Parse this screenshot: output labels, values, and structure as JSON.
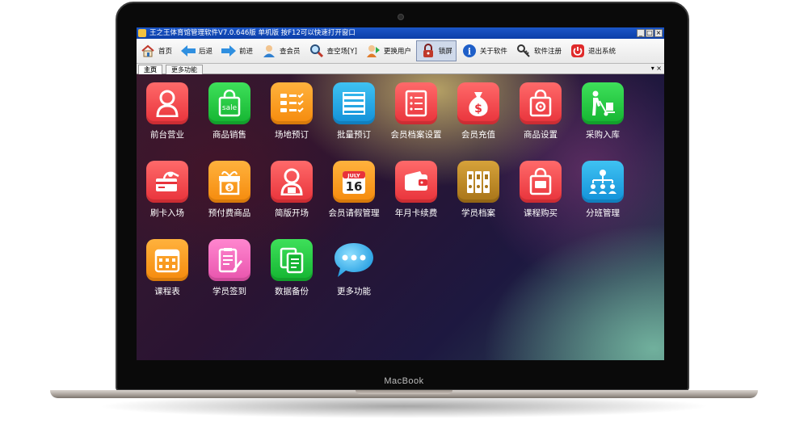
{
  "device": {
    "brand": "MacBook"
  },
  "window": {
    "title": "王之王体育馆管理软件V7.0.646版 单机版 按F12可以快速打开窗口",
    "controls": [
      "_",
      "□",
      "×"
    ]
  },
  "toolbar": {
    "items": [
      {
        "label": "首页",
        "icon": "home-icon"
      },
      {
        "label": "后退",
        "icon": "arrow-left-icon"
      },
      {
        "label": "前进",
        "icon": "arrow-right-icon"
      },
      {
        "label": "查会员",
        "icon": "member-search-icon"
      },
      {
        "label": "查空场[Y]",
        "icon": "magnifier-icon"
      },
      {
        "label": "更换用户",
        "icon": "switch-user-icon"
      },
      {
        "label": "锁屏",
        "icon": "lock-icon",
        "active": true
      },
      {
        "label": "关于软件",
        "icon": "info-icon"
      },
      {
        "label": "软件注册",
        "icon": "key-icon"
      },
      {
        "label": "退出系统",
        "icon": "power-icon"
      }
    ]
  },
  "tabs": {
    "items": [
      "主页",
      "更多功能"
    ],
    "selected": 0,
    "controls": "▾ ×"
  },
  "apps": [
    {
      "label": "前台营业",
      "color": "red",
      "icon": "receptionist-icon"
    },
    {
      "label": "商品销售",
      "color": "green",
      "icon": "sale-bag-icon",
      "icon_text": "sale"
    },
    {
      "label": "场地预订",
      "color": "orange",
      "icon": "checklist-icon"
    },
    {
      "label": "批量预订",
      "color": "blue",
      "icon": "stack-icon"
    },
    {
      "label": "会员档案设置",
      "color": "red",
      "icon": "document-list-icon"
    },
    {
      "label": "会员充值",
      "color": "red",
      "icon": "money-bag-icon"
    },
    {
      "label": "商品设置",
      "color": "red",
      "icon": "bag-gear-icon"
    },
    {
      "label": "采购入库",
      "color": "green",
      "icon": "hand-truck-icon"
    },
    {
      "label": "刷卡入场",
      "color": "red",
      "icon": "card-swipe-icon"
    },
    {
      "label": "预付费商品",
      "color": "orange",
      "icon": "gift-box-icon"
    },
    {
      "label": "简版开场",
      "color": "red",
      "icon": "receptionist-icon"
    },
    {
      "label": "会员请假管理",
      "color": "orange",
      "icon": "calendar-icon",
      "icon_month": "JULY",
      "icon_day": "16"
    },
    {
      "label": "年月卡续费",
      "color": "red",
      "icon": "wallet-icon"
    },
    {
      "label": "学员档案",
      "color": "gold",
      "icon": "binders-icon"
    },
    {
      "label": "课程购买",
      "color": "red",
      "icon": "shopping-bag-icon"
    },
    {
      "label": "分班管理",
      "color": "blue",
      "icon": "org-chart-icon"
    },
    {
      "label": "课程表",
      "color": "orange",
      "icon": "schedule-icon"
    },
    {
      "label": "学员签到",
      "color": "pink",
      "icon": "sign-in-icon"
    },
    {
      "label": "数据备份",
      "color": "green",
      "icon": "copy-docs-icon"
    },
    {
      "label": "更多功能",
      "color": "bubble",
      "icon": "chat-bubble-icon"
    }
  ]
}
